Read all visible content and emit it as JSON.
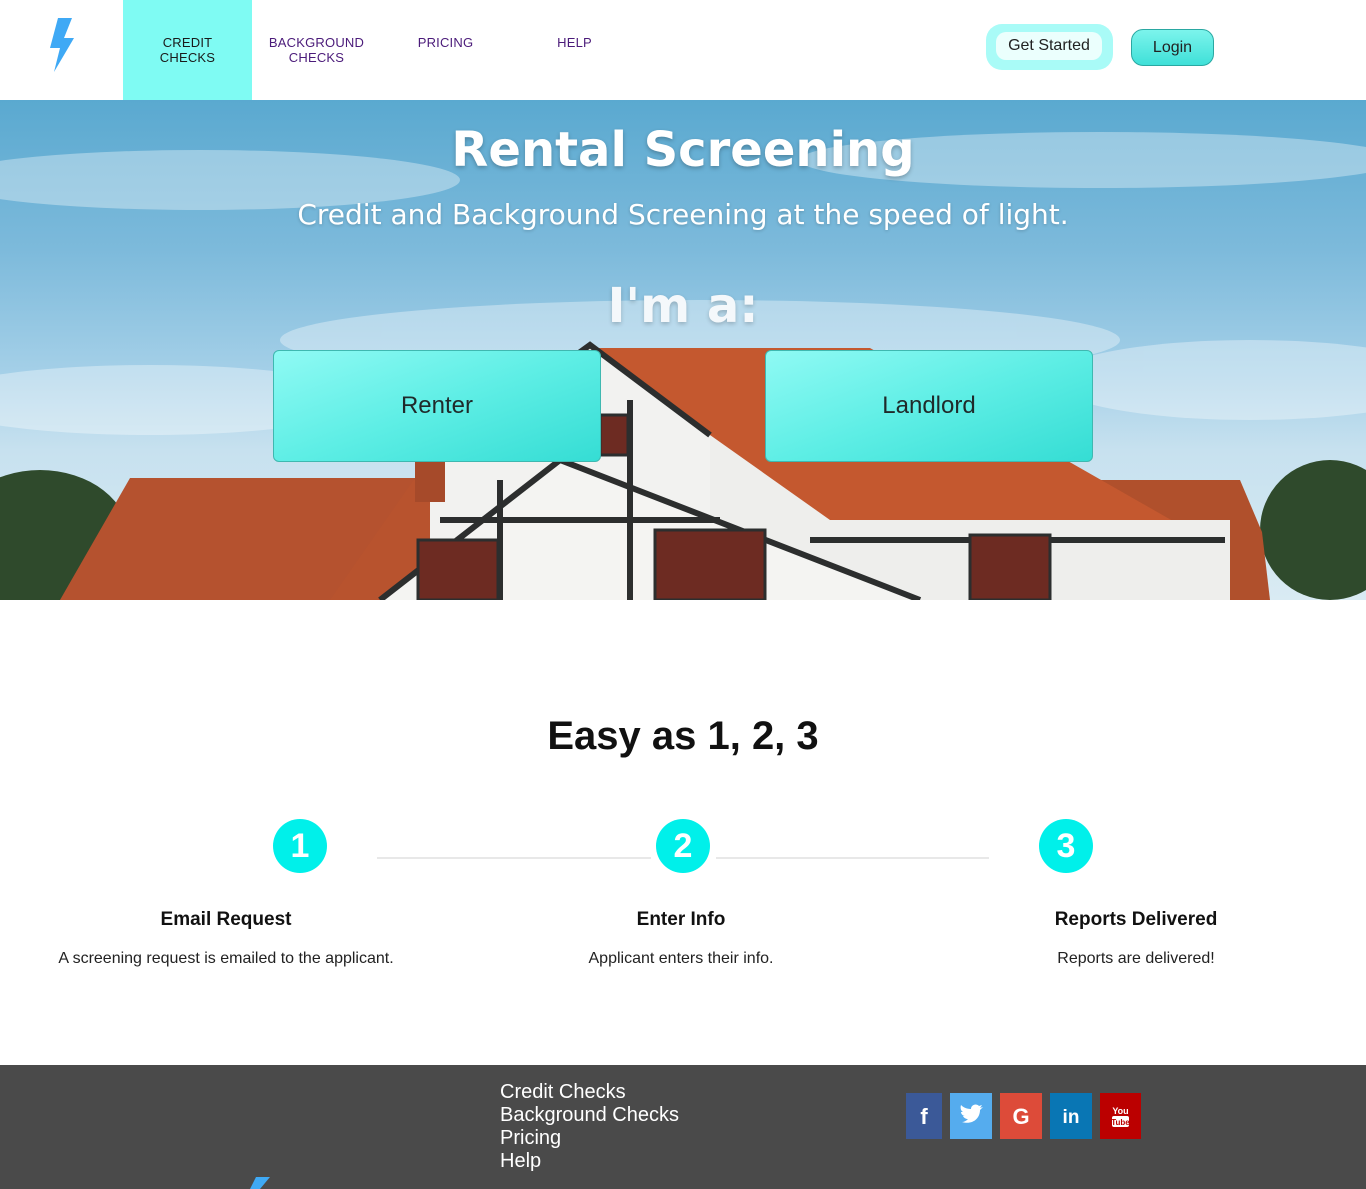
{
  "nav": {
    "items": [
      {
        "label_line1": "CREDIT",
        "label_line2": "CHECKS"
      },
      {
        "label_line1": "BACKGROUND",
        "label_line2": "CHECKS"
      },
      {
        "label_line1": "PRICING",
        "label_line2": ""
      },
      {
        "label_line1": "HELP",
        "label_line2": ""
      }
    ],
    "get_started": "Get Started",
    "login": "Login"
  },
  "hero": {
    "title": "Rental Screening",
    "subtitle": "Credit and Background Screening at the speed of light.",
    "prompt": "I'm a:",
    "choices": [
      "Renter",
      "Landlord"
    ]
  },
  "steps": {
    "title": "Easy as 1, 2, 3",
    "items": [
      {
        "number": "1",
        "heading": "Email Request",
        "text": "A screening request is emailed to the applicant."
      },
      {
        "number": "2",
        "heading": "Enter Info",
        "text": "Applicant enters their info."
      },
      {
        "number": "3",
        "heading": "Reports Delivered",
        "text": "Reports are delivered!"
      }
    ]
  },
  "footer": {
    "links": [
      "Credit Checks",
      "Background Checks",
      "Pricing",
      "Help"
    ],
    "social": [
      {
        "name": "facebook-icon",
        "glyph": "f",
        "color": "#3b5998"
      },
      {
        "name": "twitter-icon",
        "glyph": "t",
        "color": "#55acee"
      },
      {
        "name": "google-icon",
        "glyph": "G",
        "color": "#dd4b39"
      },
      {
        "name": "linkedin-icon",
        "glyph": "in",
        "color": "#0976b4"
      },
      {
        "name": "youtube-icon",
        "glyph": "You Tube",
        "color": "#b00"
      }
    ]
  },
  "colors": {
    "accent": "#7ffbf3",
    "step_circle": "#00f0ea",
    "nav_text": "#4b1b7a",
    "logo": "#3fa9f5",
    "footer_bg": "#4a4a4a"
  }
}
